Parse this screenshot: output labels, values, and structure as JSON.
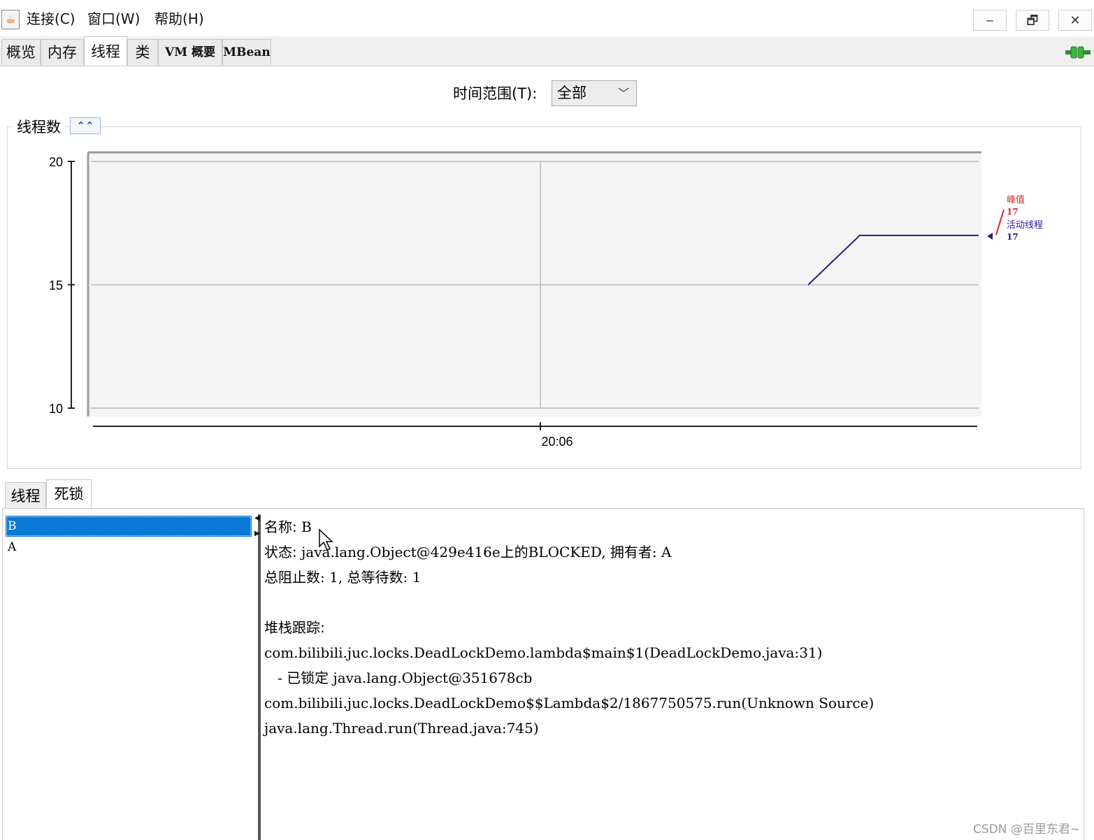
{
  "menubar": {
    "items": [
      "连接(C)",
      "窗口(W)",
      "帮助(H)"
    ],
    "minimize": "‒",
    "restore": "🗗",
    "close": "✕"
  },
  "tabs": [
    "概览",
    "内存",
    "线程",
    "类",
    "VM 概要",
    "MBean"
  ],
  "active_tab": "线程",
  "time_range": {
    "label": "时间范围(T):",
    "value": "全部"
  },
  "chart_panel": {
    "title": "线程数",
    "collapse_glyph": "⌃⌃"
  },
  "chart_data": {
    "type": "line",
    "ylim": [
      10,
      20
    ],
    "yticks": [
      20,
      15,
      10
    ],
    "xticks": [
      "20:06"
    ],
    "series": [
      {
        "name": "峰值",
        "color": "#e0202a",
        "current": 17
      },
      {
        "name": "活动线程",
        "color": "#2a1a8c",
        "current": 17,
        "points": [
          [
            0.808,
            15
          ],
          [
            0.866,
            17
          ],
          [
            1.0,
            17
          ]
        ]
      }
    ]
  },
  "lower_tabs": [
    "线程",
    "死锁"
  ],
  "active_lower_tab": "死锁",
  "deadlock_threads": [
    "B",
    "A"
  ],
  "selected_thread": "B",
  "detail": {
    "name_label": "名称:",
    "name_value": "B",
    "state_label": "状态:",
    "state_value": "java.lang.Object@429e416e上的BLOCKED, 拥有者: A",
    "counts": "总阻止数: 1, 总等待数: 1",
    "stack_label": "堆栈跟踪:",
    "stack": [
      "com.bilibili.juc.locks.DeadLockDemo.lambda$main$1(DeadLockDemo.java:31)",
      "   - 已锁定 java.lang.Object@351678cb",
      "com.bilibili.juc.locks.DeadLockDemo$$Lambda$2/1867750575.run(Unknown Source)",
      "java.lang.Thread.run(Thread.java:745)"
    ]
  },
  "watermark": "CSDN @百里东君~",
  "colors": {
    "selection": "#0a78d7",
    "peak": "#e0202a",
    "live": "#2a1a8c"
  }
}
